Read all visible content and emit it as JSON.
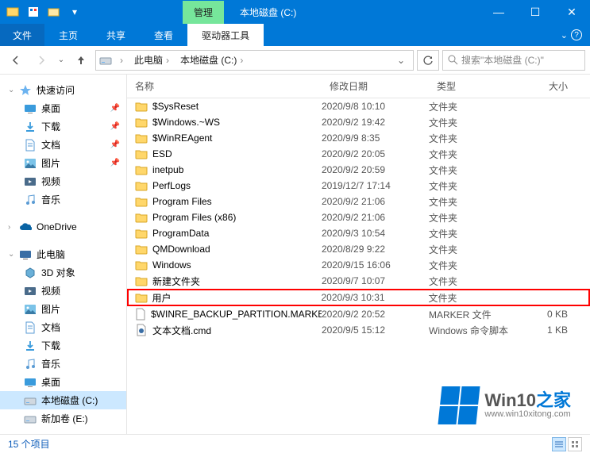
{
  "titlebar": {
    "contextual_tab": "管理",
    "window_title": "本地磁盘 (C:)",
    "minimize": "—",
    "maximize": "☐",
    "close": "✕"
  },
  "ribbon": {
    "file": "文件",
    "tabs": [
      "主页",
      "共享",
      "查看"
    ],
    "tools_tab": "驱动器工具"
  },
  "nav": {
    "crumbs": [
      "此电脑",
      "本地磁盘 (C:)"
    ],
    "search_placeholder": "搜索\"本地磁盘 (C:)\""
  },
  "sidebar": {
    "quick_access": {
      "label": "快速访问",
      "items": [
        {
          "label": "桌面",
          "pinned": true,
          "icon": "desktop"
        },
        {
          "label": "下载",
          "pinned": true,
          "icon": "downloads"
        },
        {
          "label": "文档",
          "pinned": true,
          "icon": "documents"
        },
        {
          "label": "图片",
          "pinned": true,
          "icon": "pictures"
        },
        {
          "label": "视频",
          "pinned": false,
          "icon": "videos"
        },
        {
          "label": "音乐",
          "pinned": false,
          "icon": "music"
        }
      ]
    },
    "onedrive": {
      "label": "OneDrive"
    },
    "this_pc": {
      "label": "此电脑",
      "items": [
        {
          "label": "3D 对象",
          "icon": "3d"
        },
        {
          "label": "视频",
          "icon": "videos"
        },
        {
          "label": "图片",
          "icon": "pictures"
        },
        {
          "label": "文档",
          "icon": "documents"
        },
        {
          "label": "下载",
          "icon": "downloads"
        },
        {
          "label": "音乐",
          "icon": "music"
        },
        {
          "label": "桌面",
          "icon": "desktop"
        },
        {
          "label": "本地磁盘 (C:)",
          "icon": "disk",
          "selected": true
        },
        {
          "label": "新加卷 (E:)",
          "icon": "disk"
        }
      ]
    }
  },
  "columns": {
    "name": "名称",
    "date": "修改日期",
    "type": "类型",
    "size": "大小"
  },
  "files": [
    {
      "name": "$SysReset",
      "date": "2020/9/8 10:10",
      "type": "文件夹",
      "size": "",
      "icon": "folder"
    },
    {
      "name": "$Windows.~WS",
      "date": "2020/9/2 19:42",
      "type": "文件夹",
      "size": "",
      "icon": "folder"
    },
    {
      "name": "$WinREAgent",
      "date": "2020/9/9 8:35",
      "type": "文件夹",
      "size": "",
      "icon": "folder"
    },
    {
      "name": "ESD",
      "date": "2020/9/2 20:05",
      "type": "文件夹",
      "size": "",
      "icon": "folder"
    },
    {
      "name": "inetpub",
      "date": "2020/9/2 20:59",
      "type": "文件夹",
      "size": "",
      "icon": "folder"
    },
    {
      "name": "PerfLogs",
      "date": "2019/12/7 17:14",
      "type": "文件夹",
      "size": "",
      "icon": "folder"
    },
    {
      "name": "Program Files",
      "date": "2020/9/2 21:06",
      "type": "文件夹",
      "size": "",
      "icon": "folder"
    },
    {
      "name": "Program Files (x86)",
      "date": "2020/9/2 21:06",
      "type": "文件夹",
      "size": "",
      "icon": "folder"
    },
    {
      "name": "ProgramData",
      "date": "2020/9/3 10:54",
      "type": "文件夹",
      "size": "",
      "icon": "folder"
    },
    {
      "name": "QMDownload",
      "date": "2020/8/29 9:22",
      "type": "文件夹",
      "size": "",
      "icon": "folder"
    },
    {
      "name": "Windows",
      "date": "2020/9/15 16:06",
      "type": "文件夹",
      "size": "",
      "icon": "folder"
    },
    {
      "name": "新建文件夹",
      "date": "2020/9/7 10:07",
      "type": "文件夹",
      "size": "",
      "icon": "folder"
    },
    {
      "name": "用户",
      "date": "2020/9/3 10:31",
      "type": "文件夹",
      "size": "",
      "icon": "folder",
      "highlighted": true
    },
    {
      "name": "$WINRE_BACKUP_PARTITION.MARKER",
      "date": "2020/9/2 20:52",
      "type": "MARKER 文件",
      "size": "0 KB",
      "icon": "file"
    },
    {
      "name": "文本文档.cmd",
      "date": "2020/9/5 15:12",
      "type": "Windows 命令脚本",
      "size": "1 KB",
      "icon": "cmd"
    }
  ],
  "statusbar": {
    "count": "15 个项目"
  },
  "watermark": {
    "brand_a": "Win10",
    "brand_b": "之家",
    "url": "www.win10xitong.com"
  }
}
